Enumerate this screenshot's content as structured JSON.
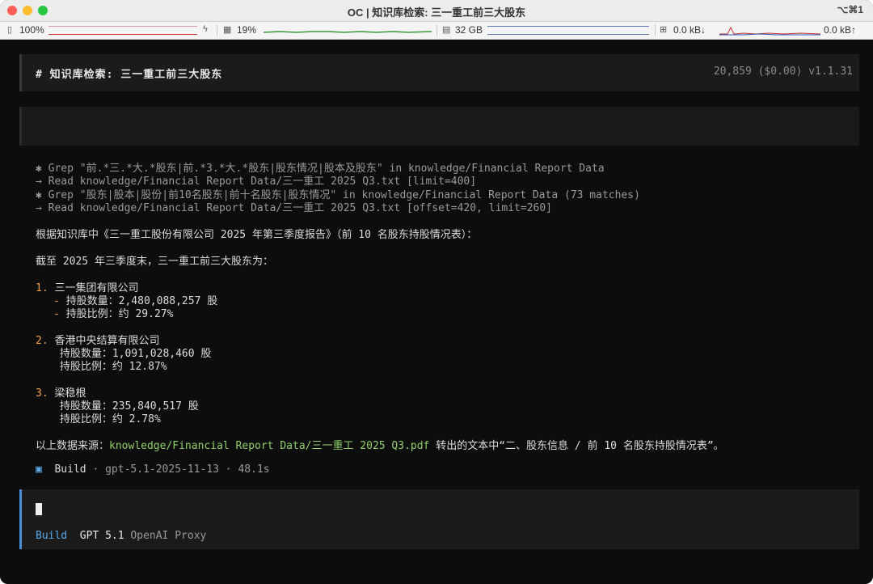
{
  "window": {
    "title": "OC | 知识库检索: 三一重工前三大股东",
    "shortcut": "⌥⌘1"
  },
  "statusbar": {
    "battery": "100%",
    "cpu": "19%",
    "memory": "32 GB",
    "net_down": "0.0 kB↓",
    "net_up": "0.0 kB↑"
  },
  "header": {
    "title": "# 知识库检索: 三一重工前三大股东",
    "meta": "20,859 ($0.00) v1.1.31"
  },
  "tool_calls": [
    {
      "icon": "✱",
      "text": "Grep \"前.*三.*大.*股东|前.*3.*大.*股东|股东情况|股本及股东\" in knowledge/Financial Report Data"
    },
    {
      "icon": "→",
      "text": "Read knowledge/Financial Report Data/三一重工 2025 Q3.txt [limit=400]"
    },
    {
      "icon": "✱",
      "text": "Grep \"股东|股本|股份|前10名股东|前十名股东|股东情况\" in knowledge/Financial Report Data (73 matches)"
    },
    {
      "icon": "→",
      "text": "Read knowledge/Financial Report Data/三一重工 2025 Q3.txt [offset=420, limit=260]"
    }
  ],
  "answer": {
    "intro": "根据知识库中《三一重工股份有限公司 2025 年第三季度报告》（前 10 名股东持股情况表）：",
    "summary": "截至 2025 年三季度末，三一重工前三大股东为：",
    "shareholders": [
      {
        "num": "1.",
        "name": "三一集团有限公司",
        "shares": "- 持股数量：2,480,088,257 股",
        "ratio": "- 持股比例：约 29.27%"
      },
      {
        "num": "2.",
        "name": "香港中央结算有限公司",
        "shares": "- 持股数量：1,091,028,460 股",
        "ratio": "- 持股比例：约 12.87%"
      },
      {
        "num": "3.",
        "name": "梁稳根",
        "shares": "- 持股数量：235,840,517 股",
        "ratio": "- 持股比例：约 2.78%"
      }
    ],
    "source_prefix": "以上数据来源：",
    "source_path": "knowledge/Financial Report Data/三一重工 2025 Q3.pdf",
    "source_suffix": " 转出的文本中“二、股东信息 / 前 10 名股东持股情况表”。"
  },
  "build_status": {
    "icon": "▣",
    "label": "Build",
    "detail": " · gpt-5.1-2025-11-13 · 48.1s"
  },
  "input": {
    "mode": "Build",
    "model": "GPT 5.1",
    "provider": "OpenAI Proxy"
  }
}
